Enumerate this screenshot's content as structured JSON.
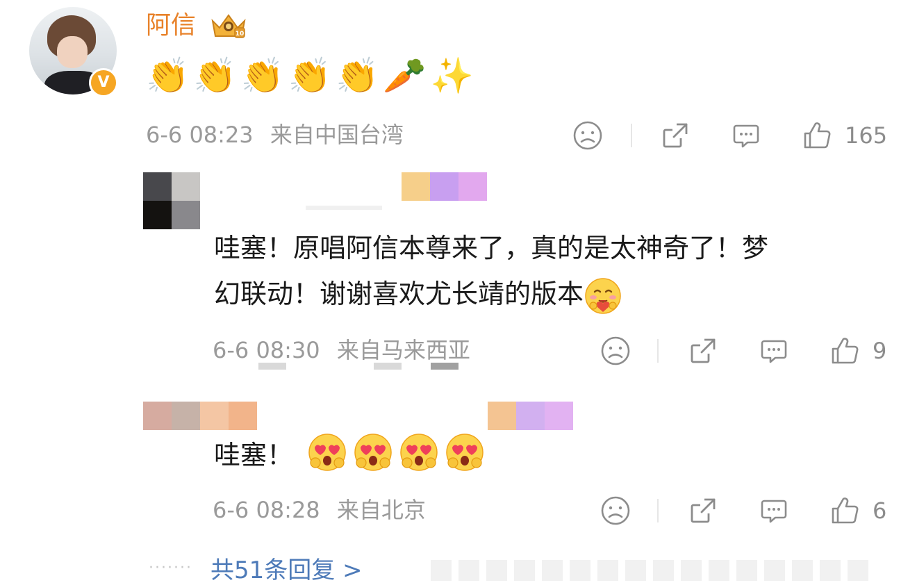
{
  "main_comment": {
    "username": "阿信",
    "verified_badge": "V",
    "emojis": [
      "👏",
      "👏",
      "👏",
      "👏",
      "👏",
      "🥕",
      "✨"
    ],
    "timestamp": "6-6 08:23",
    "location": "来自中国台湾",
    "like_count": "165",
    "icons": [
      "frown-icon",
      "share-icon",
      "comment-icon",
      "like-icon"
    ]
  },
  "replies": [
    {
      "text": "哇塞！原唱阿信本尊来了，真的是太神奇了！梦幻联动！谢谢喜欢尤长靖的版本",
      "line1": "哇塞！原唱阿信本尊来了，真的是太神奇了！梦",
      "line2": "幻联动！谢谢喜欢尤长靖的版本",
      "trailing_emoji": "hug-face",
      "timestamp": "6-6 08:30",
      "location": "来自马来西亚",
      "like_count": "9"
    },
    {
      "text": "哇塞！",
      "trailing_emojis": [
        "heart-eyes",
        "heart-eyes",
        "heart-eyes",
        "heart-eyes"
      ],
      "timestamp": "6-6 08:28",
      "location": "来自北京",
      "like_count": "6"
    }
  ],
  "more_replies": {
    "dots": "·······",
    "label": "共51条回复 >"
  },
  "colors": {
    "username": "#e8822a",
    "meta": "#9a9a9a",
    "link": "#4d7ab8",
    "badge": "#f6a623"
  }
}
